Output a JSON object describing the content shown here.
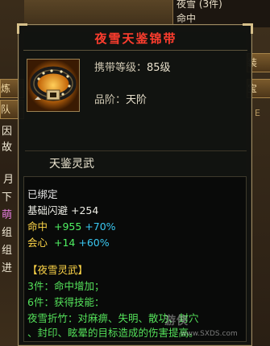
{
  "background": {
    "panel_rows": [
      "夜雪 (3件)",
      "命中"
    ],
    "left_fragments": [
      "炼",
      "队",
      "因",
      "故",
      "月",
      "下",
      "萌",
      "组",
      "组",
      "进"
    ],
    "right_fragments": [
      "装",
      "宝",
      "E"
    ]
  },
  "item": {
    "name": "夜雪天鉴锦带",
    "icon": "belt-icon",
    "level_label": "携带等级：",
    "level_value": "85级",
    "grade_label": "品阶：",
    "grade_value": "天阶",
    "set_subtitle": "天鉴灵武",
    "bound_text": "已绑定",
    "base_stat": "基础闪避  +254",
    "stats": [
      {
        "name": "命中",
        "value": "+955",
        "bonus": "+70%"
      },
      {
        "name": "会心",
        "value": "+14",
        "bonus": "+60%"
      }
    ],
    "set_name": "【夜雪灵武】",
    "set_effects": [
      "3件：命中增加；",
      "6件：获得技能：",
      "夜雪折竹：对麻痹、失明、散功、封穴",
      "、封印、眩晕的目标造成的伤害提高。"
    ]
  },
  "watermark": {
    "text": "游侠",
    "url": "www.SXDS.com"
  },
  "colors": {
    "title": "#ff3d2e",
    "gold": "#ffd648",
    "green": "#4ff062",
    "cyan": "#39c8f2"
  }
}
